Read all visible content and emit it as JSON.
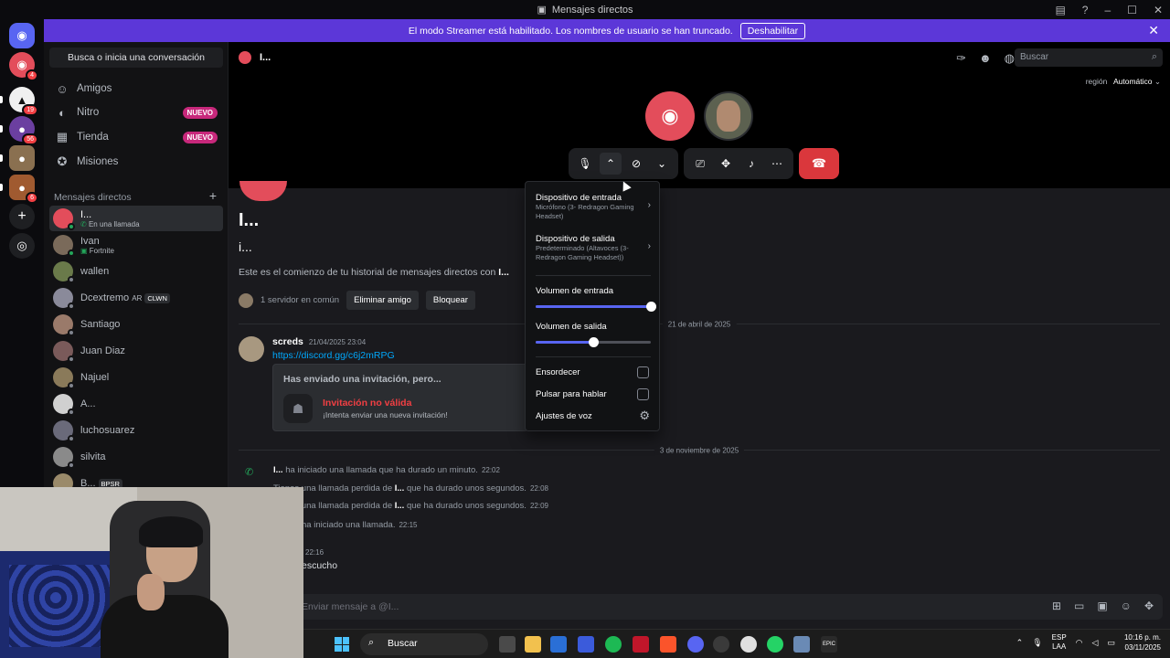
{
  "window": {
    "title": "Mensajes directos"
  },
  "banner": {
    "text": "El modo Streamer está habilitado. Los nombres de usuario se han truncado.",
    "button": "Deshabilitar"
  },
  "servers": {
    "badges": [
      "4",
      "19",
      "56",
      "6"
    ]
  },
  "sidebar": {
    "search_label": "Busca o inicia una conversación",
    "nav": [
      {
        "label": "Amigos",
        "icon": "friends-icon"
      },
      {
        "label": "Nitro",
        "icon": "nitro-icon",
        "badge": "NUEVO"
      },
      {
        "label": "Tienda",
        "icon": "shop-icon",
        "badge": "NUEVO"
      },
      {
        "label": "Misiones",
        "icon": "quests-icon"
      }
    ],
    "dm_header": "Mensajes directos",
    "dms": [
      {
        "name": "I...",
        "sub": "En una llamada"
      },
      {
        "name": "Ivan",
        "sub": "Fortnite"
      },
      {
        "name": "wallen",
        "sub": ""
      },
      {
        "name": "Dcextremo",
        "tag1": "AR",
        "tag2": "CLWN"
      },
      {
        "name": "Santiago",
        "sub": ""
      },
      {
        "name": "Juan Diaz",
        "sub": ""
      },
      {
        "name": "Najuel",
        "sub": ""
      },
      {
        "name": "A...",
        "sub": ""
      },
      {
        "name": "luchosuarez",
        "sub": ""
      },
      {
        "name": "silvita",
        "sub": ""
      },
      {
        "name": "B...",
        "tag1": "BPSR"
      }
    ]
  },
  "header": {
    "name": "I...",
    "search_placeholder": "Buscar",
    "region_label": "región",
    "region_value": "Automático"
  },
  "chat": {
    "big_name": "I...",
    "username": "i...",
    "intro_prefix": "Este es el comienzo de tu historial de mensajes directos con ",
    "intro_name": "I...",
    "mutual": "1 servidor en común",
    "remove_friend": "Eliminar amigo",
    "block": "Bloquear",
    "date1": "21 de abril de 2025",
    "msg_author": "screds",
    "msg_time": "21/04/2025 23:04",
    "msg_link": "https://discord.gg/c6j2mRPG",
    "invite_header": "Has enviado una invitación, pero...",
    "invite_title": "Invitación no válida",
    "invite_sub": "¡Intenta enviar una nueva invitación!",
    "date2": "3 de noviembre de 2025",
    "sys": [
      {
        "who": "I...",
        "text": " ha iniciado una llamada que ha durado un minuto.",
        "time": "22:02"
      },
      {
        "pre": "Tienes una llamada perdida de ",
        "who": "I...",
        "text": " que ha durado unos segundos.",
        "time": "22:08"
      },
      {
        "pre": "Tienes una llamada perdida de ",
        "who": "I...",
        "text": " que ha durado unos segundos.",
        "time": "22:09"
      },
      {
        "who": "",
        "text": "ha iniciado una llamada.",
        "time": "22:15"
      }
    ],
    "last_time": "22:16",
    "last_text": "escucho",
    "composer_placeholder": "Enviar mensaje a @I..."
  },
  "voice_menu": {
    "input_device_title": "Dispositivo de entrada",
    "input_device_value": "Micrófono (3- Redragon Gaming Headset)",
    "output_device_title": "Dispositivo de salida",
    "output_device_value": "Predeterminado (Altavoces (3- Redragon Gaming Headset))",
    "input_volume_label": "Volumen de entrada",
    "input_volume": 1.0,
    "output_volume_label": "Volumen de salida",
    "output_volume": 0.5,
    "deafen_label": "Ensordecer",
    "ptt_label": "Pulsar para hablar",
    "voice_settings_label": "Ajustes de voz"
  },
  "taskbar": {
    "search": "Buscar",
    "lang1": "ESP",
    "lang2": "LAA",
    "time": "10:16 p. m.",
    "date": "03/11/2025"
  },
  "colors": {
    "accent": "#5865f2",
    "banner": "#5c37d8",
    "danger": "#da373c",
    "nuevo": "#c7287b"
  }
}
